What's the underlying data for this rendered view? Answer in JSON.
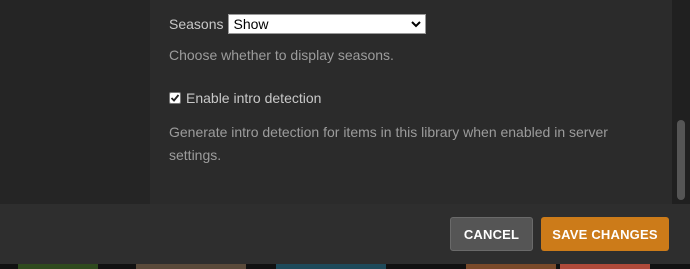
{
  "seasons": {
    "label": "Seasons",
    "selected": "Show",
    "help": "Choose whether to display seasons."
  },
  "intro_detection": {
    "label": "Enable intro detection",
    "checked": true,
    "help": "Generate intro detection for items in this library when enabled in server settings."
  },
  "footer": {
    "cancel_label": "CANCEL",
    "save_label": "SAVE CHANGES"
  },
  "colors": {
    "accent": "#cc7b19",
    "panel": "#2b2b2b",
    "cancel_bg": "#555555"
  }
}
